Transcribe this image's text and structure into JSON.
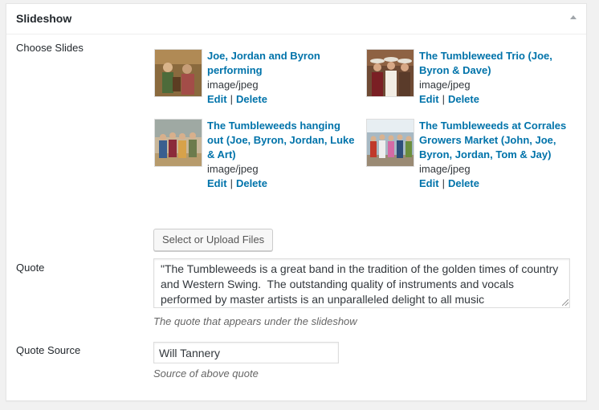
{
  "metabox": {
    "title": "Slideshow",
    "toggle_icon": "arrow-up-icon"
  },
  "fields": {
    "choose_slides_label": "Choose Slides",
    "quote_label": "Quote",
    "quote_source_label": "Quote Source"
  },
  "slides": [
    {
      "title": "Joe, Jordan and Byron performing",
      "mime": "image/jpeg",
      "edit": "Edit",
      "delete": "Delete",
      "separator": "|"
    },
    {
      "title": "The Tumbleweed Trio (Joe, Byron & Dave)",
      "mime": "image/jpeg",
      "edit": "Edit",
      "delete": "Delete",
      "separator": "|"
    },
    {
      "title": "The Tumbleweeds hanging out (Joe, Byron, Jordan, Luke & Art)",
      "mime": "image/jpeg",
      "edit": "Edit",
      "delete": "Delete",
      "separator": "|"
    },
    {
      "title": "The Tumbleweeds at Corrales Growers Market (John, Joe, Byron, Jordan, Tom & Jay)",
      "mime": "image/jpeg",
      "edit": "Edit",
      "delete": "Delete",
      "separator": "|"
    }
  ],
  "upload_button": "Select or Upload Files",
  "quote": {
    "value": "\"The Tumbleweeds is a great band in the tradition of the golden times of country and Western Swing.  The outstanding quality of instruments and vocals performed by master artists is an unparalleled delight to all music",
    "description": "The quote that appears under the slideshow"
  },
  "quote_source": {
    "value": "Will Tannery",
    "description": "Source of above quote"
  },
  "colors": {
    "link": "#0073aa",
    "border": "#dddddd",
    "background": "#f1f1f1"
  }
}
